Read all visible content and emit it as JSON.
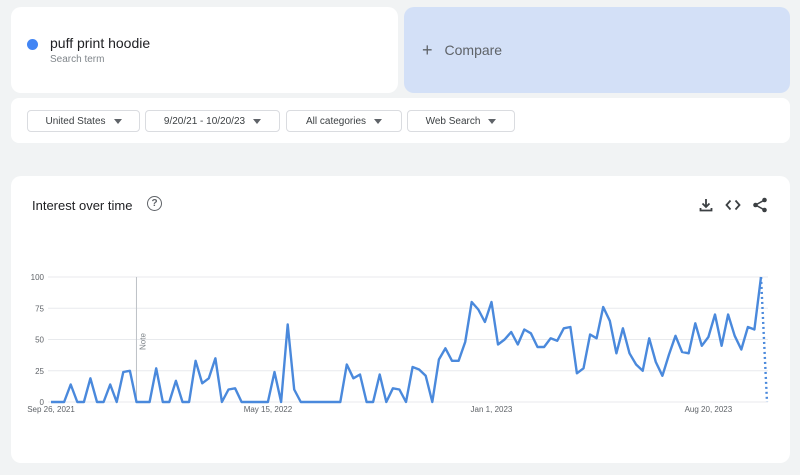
{
  "search_term": {
    "name": "puff print hoodie",
    "subtitle": "Search term",
    "dot_color": "#4285f4"
  },
  "compare": {
    "label": "Compare",
    "icon": "plus-icon",
    "background": "#d3e0f7"
  },
  "filters": [
    {
      "label": "United States"
    },
    {
      "label": "9/20/21 - 10/20/23"
    },
    {
      "label": "All categories"
    },
    {
      "label": "Web Search"
    }
  ],
  "chart_panel": {
    "title": "Interest over time",
    "help_icon": "question-circle-icon",
    "tools": [
      "download-icon",
      "embed-code-icon",
      "share-icon"
    ]
  },
  "chart_data": {
    "type": "line",
    "series": [
      {
        "color": "#4a89dc",
        "values": [
          0,
          0,
          0,
          14,
          0,
          0,
          19,
          0,
          0,
          14,
          0,
          24,
          25,
          0,
          0,
          0,
          27,
          0,
          0,
          17,
          0,
          0,
          33,
          15,
          19,
          35,
          0,
          10,
          11,
          0,
          0,
          0,
          0,
          0,
          24,
          0,
          62,
          10,
          0,
          0,
          0,
          0,
          0,
          0,
          0,
          30,
          19,
          22,
          0,
          0,
          22,
          0,
          11,
          10,
          0,
          28,
          26,
          21,
          0,
          34,
          43,
          33,
          33,
          48,
          80,
          74,
          64,
          80,
          46,
          50,
          56,
          46,
          58,
          55,
          44,
          44,
          51,
          49,
          59,
          60,
          23,
          27,
          54,
          51,
          76,
          65,
          39,
          59,
          39,
          30,
          25,
          51,
          32,
          21,
          38,
          53,
          40,
          39,
          63,
          45,
          52,
          70,
          45,
          70,
          53,
          42,
          60,
          58,
          100
        ],
        "projected_end": 0
      }
    ],
    "y_ticks": [
      0,
      25,
      50,
      75,
      100
    ],
    "ylim": [
      0,
      100
    ],
    "x_tick_labels": [
      "Sep 26, 2021",
      "May 15, 2022",
      "Jan 1, 2023",
      "Aug 20, 2023"
    ],
    "x_tick_index": [
      0,
      33,
      67,
      100
    ],
    "annotation": {
      "label": "Note",
      "index": 13
    },
    "grid": true,
    "ytick_color": "#5f6368",
    "grid_color": "#e8eaed"
  }
}
